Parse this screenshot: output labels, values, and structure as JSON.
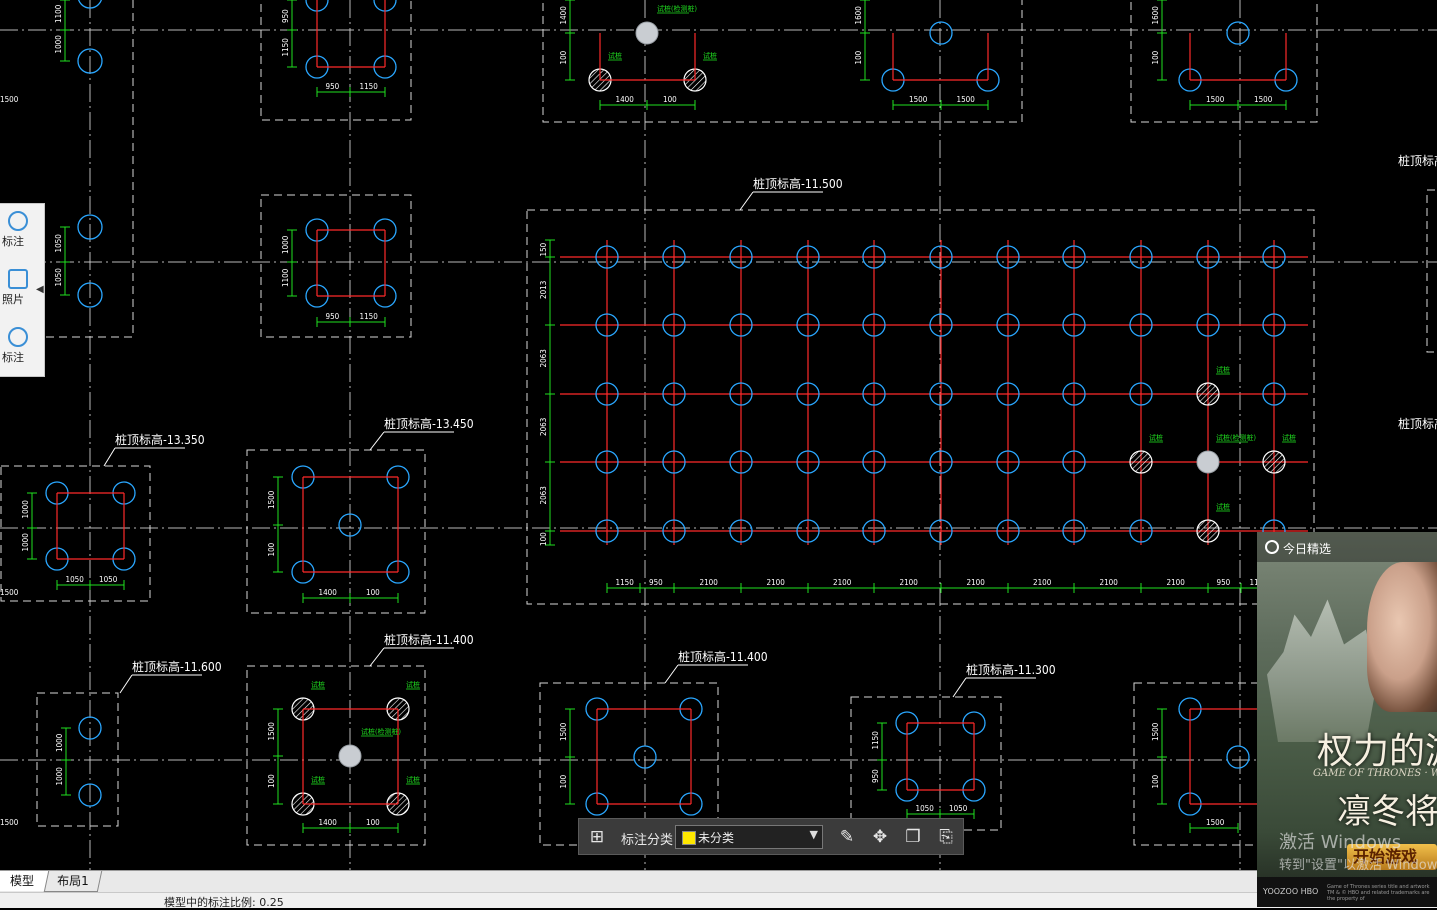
{
  "drawing": {
    "elev_labels": [
      "桩顶标高-11.500",
      "桩顶标高-13.350",
      "桩顶标高-13.450",
      "桩顶标高-11.400",
      "桩顶标高-11.600",
      "桩顶标高-11.400",
      "桩顶标高-11.300",
      "桩顶标高-",
      "桩顶标高-"
    ],
    "small_tags": [
      "试桩",
      "试桩(检测桩)"
    ],
    "big_dims_x": [
      "1150",
      "950",
      "2100",
      "2100",
      "2100",
      "2100",
      "2100",
      "2100",
      "2100",
      "2100",
      "950",
      "11"
    ],
    "big_dims_y": [
      "150",
      "2013",
      "2063",
      "2063",
      "2063",
      "100"
    ]
  },
  "left_panel": {
    "tools": [
      "标注",
      "照片",
      "标注"
    ]
  },
  "annotation_toolbar": {
    "label": "标注分类",
    "select_value": "未分类",
    "swatch_color": "#ffe800",
    "icons": [
      "grid-icon",
      "edit-icon",
      "move-icon",
      "copy-icon",
      "paste-icon"
    ]
  },
  "tabs": {
    "model": "模型",
    "layout": "布局1"
  },
  "status": {
    "text": "模型中的标注比例: 0.25"
  },
  "ad": {
    "header": "今日精选",
    "title1": "权力的游",
    "subtitle": "GAME OF THRONES · WINTER",
    "title2": "凛冬将",
    "watermark1": "激活 Windows",
    "watermark2": "转到\"设置\"以激活 Windows",
    "play_button": "开始游戏",
    "footer_left": "YOOZOO  HBO",
    "footer_right": "Game of Thrones series title and artwork TM & © HBO and related trademarks are the property of"
  }
}
